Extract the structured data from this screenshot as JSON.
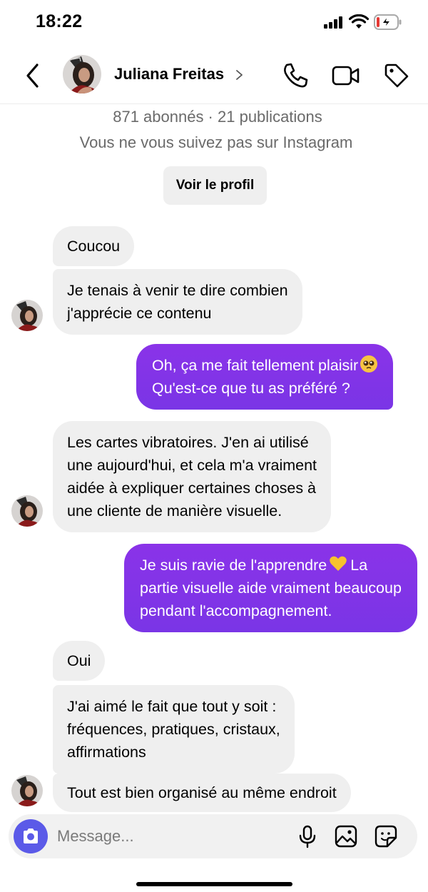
{
  "status_bar": {
    "time": "18:22",
    "battery_level": 0.1,
    "battery_color": "#e53935"
  },
  "header": {
    "name": "Juliana Freitas"
  },
  "profile": {
    "stats": "871 abonnés · 21 publications",
    "follow_status": "Vous ne vous suivez pas sur Instagram",
    "view_profile_label": "Voir le profil"
  },
  "messages": [
    {
      "from": "them",
      "lines": [
        "Coucou"
      ]
    },
    {
      "from": "them",
      "lines": [
        "Je tenais à venir te dire combien",
        "j'apprécie ce contenu"
      ]
    },
    {
      "from": "me",
      "lines": [
        "Oh, ça me fait tellement plaisir",
        "Qu'est-ce que tu as préféré ?"
      ],
      "emoji": "pleading-face"
    },
    {
      "from": "them",
      "lines": [
        "Les cartes vibratoires. J'en ai utilisé",
        "une aujourd'hui, et cela m'a vraiment",
        "aidée à expliquer certaines choses à",
        "une cliente de manière visuelle."
      ]
    },
    {
      "from": "me",
      "lines": [
        "Je suis ravie de l'apprendre",
        "partie visuelle aide vraiment beaucoup",
        "pendant l'accompagnement."
      ],
      "emoji": "yellow-heart",
      "line1_after_emoji": "La"
    },
    {
      "from": "them",
      "lines": [
        "Oui"
      ]
    },
    {
      "from": "them",
      "lines": [
        "J'ai aimé le fait que tout y soit :",
        "fréquences, pratiques, cristaux,",
        "affirmations"
      ]
    },
    {
      "from": "them",
      "lines": [
        "Tout est bien organisé au même endroit"
      ]
    }
  ],
  "composer": {
    "placeholder": "Message..."
  },
  "colors": {
    "sent_bubble": "#7d34e7",
    "received_bubble": "#efefef",
    "camera_button": "#5b5ae8"
  },
  "icons": [
    "back-chevron-icon",
    "chevron-right-icon",
    "phone-icon",
    "video-camera-icon",
    "tag-icon",
    "camera-icon",
    "microphone-icon",
    "image-icon",
    "sticker-icon"
  ]
}
